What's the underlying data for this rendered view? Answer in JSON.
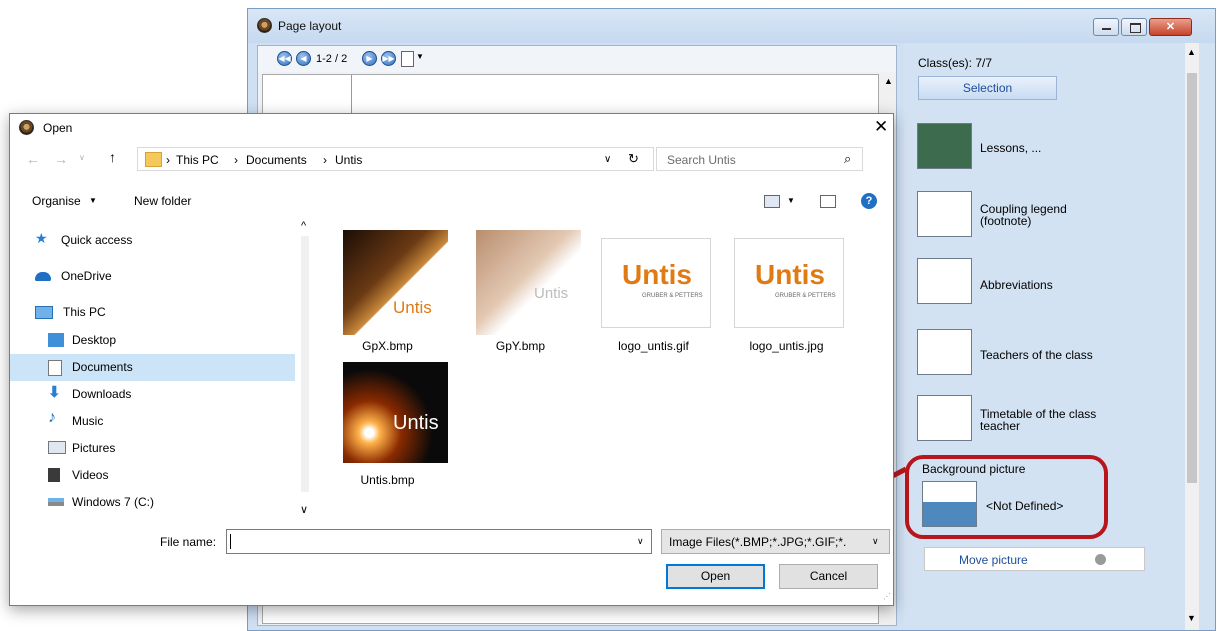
{
  "page_layout": {
    "title": "Page layout",
    "pager": "1-2 / 2",
    "classes_count": "Class(es): 7/7",
    "selection_button": "Selection",
    "items": [
      {
        "label": "Lessons, ...",
        "icon": "blackboard-icon"
      },
      {
        "label": "Coupling legend (footnote)",
        "icon": "coupling-legend-icon"
      },
      {
        "label": "Abbreviations",
        "icon": "abbreviations-icon"
      },
      {
        "label": "Teachers of the class",
        "icon": "teachers-icon"
      },
      {
        "label": "Timetable of the class teacher",
        "icon": "class-teacher-timetable-icon"
      }
    ],
    "background_picture_label": "Background picture",
    "background_picture_value": "<Not Defined>",
    "move_picture_button": "Move picture"
  },
  "open_dialog": {
    "title": "Open",
    "breadcrumb": [
      "This PC",
      "Documents",
      "Untis"
    ],
    "search_placeholder": "Search Untis",
    "organise_label": "Organise",
    "new_folder_label": "New folder",
    "nav_items": [
      {
        "label": "Quick access",
        "icon": "star-icon"
      },
      {
        "label": "OneDrive",
        "icon": "cloud-icon"
      },
      {
        "label": "This PC",
        "icon": "computer-icon"
      },
      {
        "label": "Desktop",
        "icon": "desktop-icon"
      },
      {
        "label": "Documents",
        "icon": "documents-icon",
        "selected": true
      },
      {
        "label": "Downloads",
        "icon": "download-icon"
      },
      {
        "label": "Music",
        "icon": "music-icon"
      },
      {
        "label": "Pictures",
        "icon": "pictures-icon"
      },
      {
        "label": "Videos",
        "icon": "videos-icon"
      },
      {
        "label": "Windows 7 (C:)",
        "icon": "drive-icon"
      }
    ],
    "files": [
      {
        "name": "GpX.bmp",
        "thumb_text": "Untis"
      },
      {
        "name": "GpY.bmp",
        "thumb_text": "Untis"
      },
      {
        "name": "logo_untis.gif",
        "thumb_text": "Untis",
        "thumb_sub": "GRUBER & PETTERS"
      },
      {
        "name": "logo_untis.jpg",
        "thumb_text": "Untis",
        "thumb_sub": "GRUBER & PETTERS"
      },
      {
        "name": "Untis.bmp",
        "thumb_text": "Untis"
      }
    ],
    "file_name_label": "File name:",
    "file_name_value": "",
    "filter_value": "Image Files(*.BMP;*.JPG;*.GIF;*.",
    "open_button": "Open",
    "cancel_button": "Cancel"
  },
  "colors": {
    "accent": "#0078d7",
    "highlight_ring": "#b8161c",
    "selected_nav": "#cce4f7"
  }
}
